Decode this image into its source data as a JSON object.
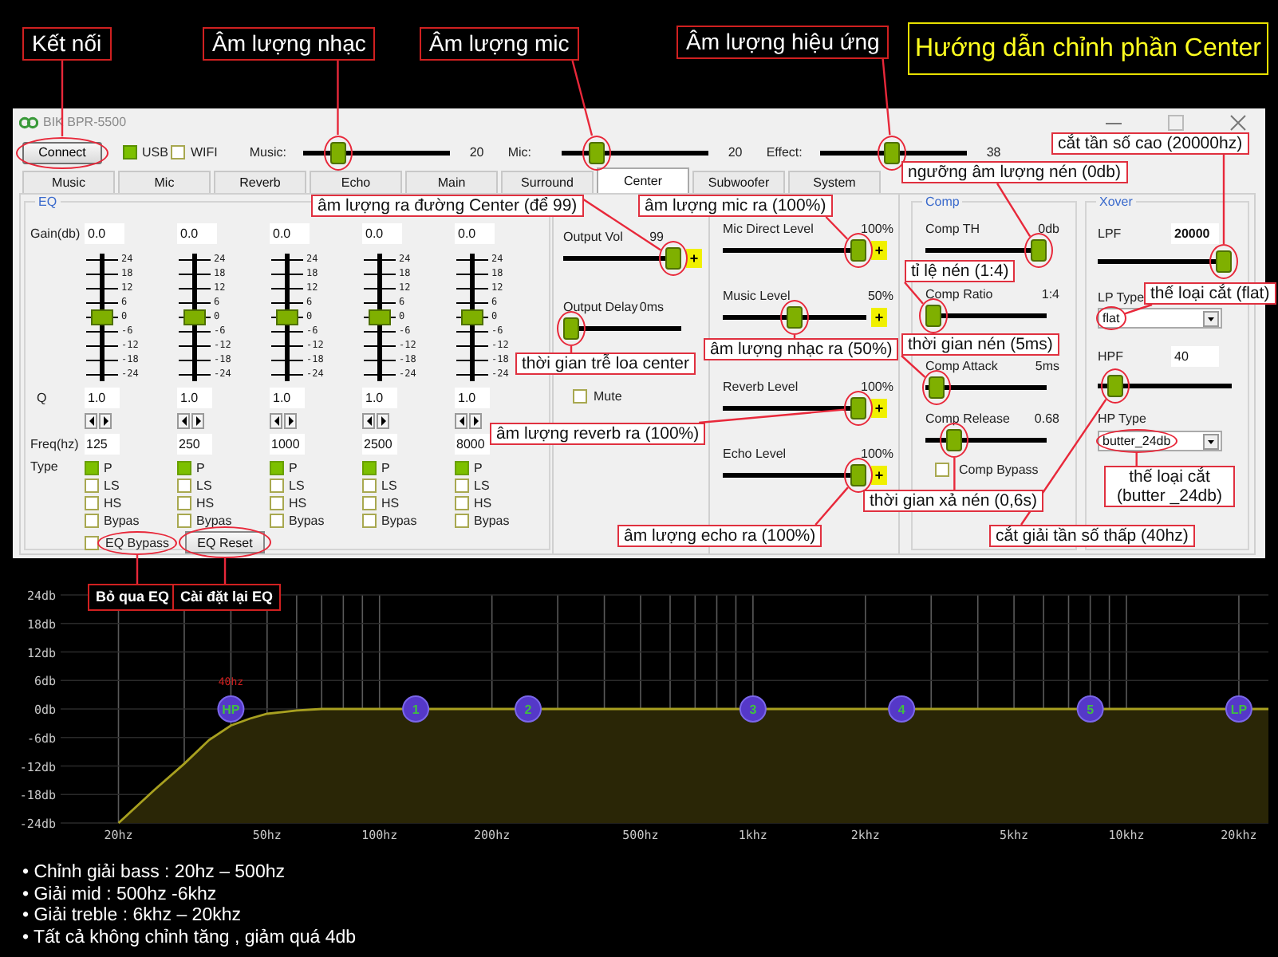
{
  "guide_title": "Hướng dẫn chỉnh phần Center",
  "window": {
    "title": "BIK BPR-5500"
  },
  "toolbar": {
    "connect": {
      "label": "Connect",
      "circled": true
    },
    "usb": {
      "label": "USB",
      "on": true
    },
    "wifi": {
      "label": "WIFI",
      "checked": false
    },
    "volumes": [
      {
        "label": "Music:",
        "level": 0.2,
        "reading": "20",
        "circled": true
      },
      {
        "label": "Mic:",
        "level": 0.2,
        "reading": "20",
        "circled": true
      },
      {
        "label": "Effect:",
        "level": 0.48,
        "reading": "38",
        "circled": true
      }
    ]
  },
  "tabs": [
    {
      "label": "Music",
      "selected": false
    },
    {
      "label": "Mic",
      "selected": false
    },
    {
      "label": "Reverb",
      "selected": false
    },
    {
      "label": "Echo",
      "selected": false
    },
    {
      "label": "Main",
      "selected": false
    },
    {
      "label": "Surround",
      "selected": false
    },
    {
      "label": "Center",
      "selected": true
    },
    {
      "label": "Subwoofer",
      "selected": false
    },
    {
      "label": "System",
      "selected": false
    }
  ],
  "eq": {
    "title": "EQ",
    "row_labels": {
      "gain": "Gain(db)",
      "q": "Q",
      "freq": "Freq(hz)",
      "type": "Type"
    },
    "bands": [
      {
        "gain": "0.0",
        "level": 0.5,
        "scale": [
          "24",
          "18",
          "12",
          "6",
          "0",
          "-6",
          "-12",
          "-18",
          "-24"
        ],
        "q": "1.0",
        "freq": "125",
        "types": [
          {
            "label": "P",
            "checked": true
          },
          {
            "label": "LS",
            "checked": false
          },
          {
            "label": "HS",
            "checked": false
          },
          {
            "label": "Bypas",
            "checked": false
          }
        ]
      },
      {
        "gain": "0.0",
        "level": 0.5,
        "scale": [
          "24",
          "18",
          "12",
          "6",
          "0",
          "-6",
          "-12",
          "-18",
          "-24"
        ],
        "q": "1.0",
        "freq": "250",
        "types": [
          {
            "label": "P",
            "checked": true
          },
          {
            "label": "LS",
            "checked": false
          },
          {
            "label": "HS",
            "checked": false
          },
          {
            "label": "Bypas",
            "checked": false
          }
        ]
      },
      {
        "gain": "0.0",
        "level": 0.5,
        "scale": [
          "24",
          "18",
          "12",
          "6",
          "0",
          "-6",
          "-12",
          "-18",
          "-24"
        ],
        "q": "1.0",
        "freq": "1000",
        "types": [
          {
            "label": "P",
            "checked": true
          },
          {
            "label": "LS",
            "checked": false
          },
          {
            "label": "HS",
            "checked": false
          },
          {
            "label": "Bypas",
            "checked": false
          }
        ]
      },
      {
        "gain": "0.0",
        "level": 0.5,
        "scale": [
          "24",
          "18",
          "12",
          "6",
          "0",
          "-6",
          "-12",
          "-18",
          "-24"
        ],
        "q": "1.0",
        "freq": "2500",
        "types": [
          {
            "label": "P",
            "checked": true
          },
          {
            "label": "LS",
            "checked": false
          },
          {
            "label": "HS",
            "checked": false
          },
          {
            "label": "Bypas",
            "checked": false
          }
        ]
      },
      {
        "gain": "0.0",
        "level": 0.5,
        "scale": [
          "24",
          "18",
          "12",
          "6",
          "0",
          "-6",
          "-12",
          "-18",
          "-24"
        ],
        "q": "1.0",
        "freq": "8000",
        "types": [
          {
            "label": "P",
            "checked": true
          },
          {
            "label": "LS",
            "checked": false
          },
          {
            "label": "HS",
            "checked": false
          },
          {
            "label": "Bypas",
            "checked": false
          }
        ]
      }
    ],
    "bypass": {
      "label": "EQ Bypass",
      "checked": false,
      "circled": true
    },
    "reset": {
      "label": "EQ Reset",
      "circled": true
    }
  },
  "center": {
    "controls": [
      {
        "label": "Output Vol",
        "reading": "99",
        "level": 1,
        "circled": true,
        "plus_button": "+"
      },
      {
        "label": "Output Delay",
        "reading": "0ms",
        "level": 0,
        "circled": true
      }
    ],
    "mute": {
      "label": "Mute",
      "checked": false
    }
  },
  "levels": [
    {
      "label": "Mic Direct Level",
      "reading": "100%",
      "level": 1,
      "circled": true,
      "plus_button": "+"
    },
    {
      "label": "Music Level",
      "reading": "50%",
      "level": 0.5,
      "circled": true,
      "plus_button": "+"
    },
    {
      "label": "Reverb Level",
      "reading": "100%",
      "level": 1,
      "circled": true,
      "plus_button": "+"
    },
    {
      "label": "Echo Level",
      "reading": "100%",
      "level": 1,
      "circled": true,
      "plus_button": "+"
    }
  ],
  "comp": {
    "title": "Comp",
    "controls": [
      {
        "label": "Comp TH",
        "reading": "0db",
        "level": 1,
        "circled": true
      },
      {
        "label": "Comp Ratio",
        "reading": "1:4",
        "level": 0,
        "circled": true
      },
      {
        "label": "Comp Attack",
        "reading": "5ms",
        "level": 0.03,
        "circled": true
      },
      {
        "label": "Comp Release",
        "reading": "0.68",
        "level": 0.2,
        "circled": true
      }
    ],
    "bypass": {
      "label": "Comp Bypass",
      "checked": false
    }
  },
  "xover": {
    "title": "Xover",
    "lpf": {
      "label": "LPF",
      "value": "20000",
      "level": 1,
      "circled": true
    },
    "lp_type": {
      "label": "LP Type",
      "value": "flat",
      "circled": true
    },
    "hpf": {
      "label": "HPF",
      "value": "40",
      "level": 0.08,
      "circled": true
    },
    "hp_type": {
      "label": "HP Type",
      "value": "butter_24db",
      "circled": true
    }
  },
  "graph": {
    "y_labels": [
      "24db",
      "18db",
      "12db",
      "6db",
      "0db",
      "-6db",
      "-12db",
      "-18db",
      "-24db"
    ],
    "x_labels": [
      "20hz",
      "50hz",
      "100hz",
      "200hz",
      "500hz",
      "1khz",
      "2khz",
      "5khz",
      "10khz",
      "20khz"
    ],
    "nodes": [
      "HP",
      "1",
      "2",
      "3",
      "4",
      "5",
      "LP"
    ],
    "cutoff_label": "40hz"
  },
  "callouts": [
    {
      "text": "Kết nối"
    },
    {
      "text": "Âm lượng nhạc"
    },
    {
      "text": "Âm lượng mic"
    },
    {
      "text": "Âm lượng hiệu ứng"
    },
    {
      "text": "cắt tần số cao (20000hz)"
    },
    {
      "text": "ngưỡng âm lượng nén (0db)"
    },
    {
      "text": "âm lượng ra đường Center (để 99)"
    },
    {
      "text": "âm lượng mic ra (100%)"
    },
    {
      "text": "tỉ lệ nén (1:4)"
    },
    {
      "text": "thế loại cắt (flat)"
    },
    {
      "text": "thời gian trễ loa center"
    },
    {
      "text": "âm lượng nhạc ra (50%)"
    },
    {
      "text": "thời gian nén (5ms)"
    },
    {
      "text": "âm lượng reverb ra (100%)"
    },
    {
      "text": "thời gian xả nén (0,6s)"
    },
    {
      "text": "thế loại cắt (butter _24db)"
    },
    {
      "text": "âm lượng echo ra (100%)"
    },
    {
      "text": "cắt giải tần số thấp (40hz)"
    },
    {
      "text": "Bỏ qua EQ"
    },
    {
      "text": "Cài đặt lại EQ"
    }
  ],
  "notes": [
    "• Chỉnh giải bass : 20hz – 500hz",
    "• Giải mid : 500hz -6khz",
    "• Giải treble : 6khz – 20khz",
    "• Tất cả không chỉnh tăng , giảm quá 4db"
  ]
}
